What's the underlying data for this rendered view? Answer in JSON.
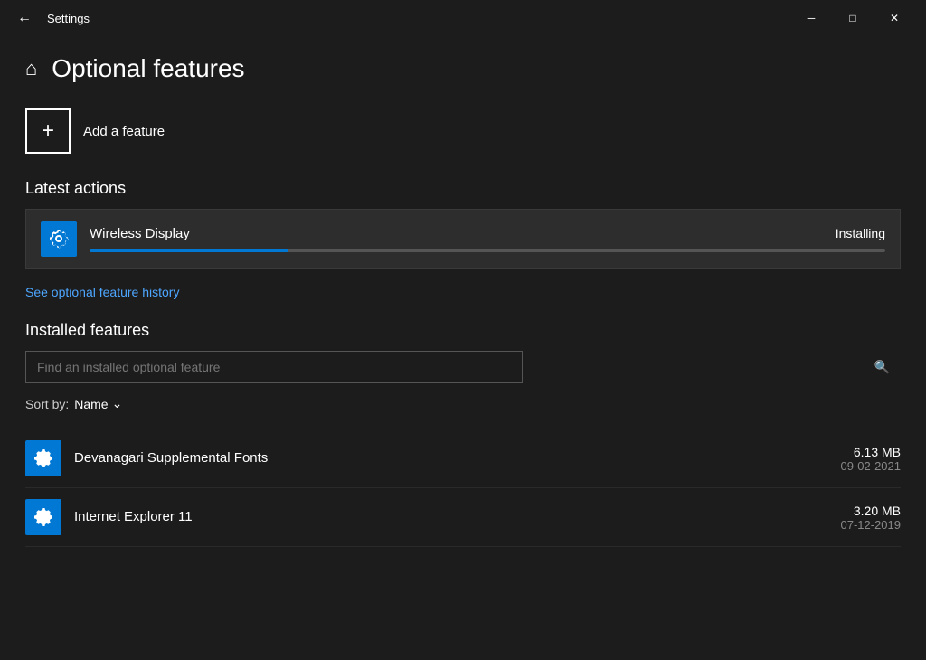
{
  "titleBar": {
    "title": "Settings",
    "backArrow": "←",
    "minimizeLabel": "─",
    "maximizeLabel": "□",
    "closeLabel": "✕"
  },
  "pageHeader": {
    "homeIcon": "⌂",
    "title": "Optional features"
  },
  "addFeature": {
    "plusIcon": "+",
    "label": "Add a feature"
  },
  "latestActions": {
    "sectionHeader": "Latest actions",
    "item": {
      "name": "Wireless Display",
      "status": "Installing",
      "progressPercent": 25
    }
  },
  "historyLink": "See optional feature history",
  "installedFeatures": {
    "sectionHeader": "Installed features",
    "searchPlaceholder": "Find an installed optional feature",
    "searchIcon": "🔍",
    "sortBy": "Sort by:",
    "sortValue": "Name",
    "sortArrow": "⌄",
    "items": [
      {
        "name": "Devanagari Supplemental Fonts",
        "size": "6.13 MB",
        "date": "09-02-2021"
      },
      {
        "name": "Internet Explorer 11",
        "size": "3.20 MB",
        "date": "07-12-2019"
      }
    ]
  }
}
